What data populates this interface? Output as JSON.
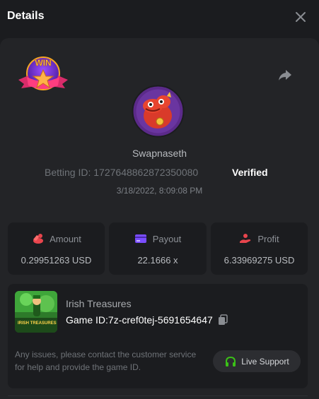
{
  "header": {
    "title": "Details"
  },
  "bet": {
    "username": "Swapnaseth",
    "betting_id_label": "Betting ID:",
    "betting_id": "1727648862872350080",
    "verified": "Verified",
    "datetime": "3/18/2022, 8:09:08 PM",
    "badge_text": "WIN"
  },
  "stats": {
    "amount": {
      "label": "Amount",
      "value": "0.29951263 USD",
      "icon": "coins-icon"
    },
    "payout": {
      "label": "Payout",
      "value": "22.1666 x",
      "icon": "card-icon"
    },
    "profit": {
      "label": "Profit",
      "value": "6.33969275 USD",
      "icon": "hand-coin-icon"
    }
  },
  "game": {
    "name": "Irish Treasures",
    "id_label": "Game ID:",
    "id": "7z-cref0tej-5691654647",
    "thumb_text": "IRISH TREASURES"
  },
  "help": {
    "text": "Any issues, please contact the customer service for help and provide the game ID.",
    "support_label": "Live Support"
  },
  "colors": {
    "background": "#1b1c1f",
    "panel": "#232427",
    "amount_icon": "#e8454d",
    "payout_icon": "#7a4dff",
    "profit_icon": "#e8454d",
    "support_icon": "#3bc117"
  }
}
